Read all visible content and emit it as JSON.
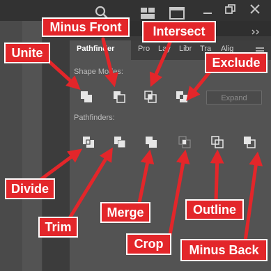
{
  "panel": {
    "tabs": [
      {
        "label": "Pathfinder",
        "active": true
      },
      {
        "label": "Pro",
        "active": false
      },
      {
        "label": "Lay",
        "active": false
      },
      {
        "label": "Libr",
        "active": false
      },
      {
        "label": "Tra",
        "active": false
      },
      {
        "label": "Alig",
        "active": false
      }
    ],
    "shape_modes_label": "Shape Modes:",
    "pathfinders_label": "Pathfinders:",
    "expand_label": "Expand"
  },
  "callouts": {
    "unite": "Unite",
    "minus_front": "Minus Front",
    "intersect": "Intersect",
    "exclude": "Exclude",
    "divide": "Divide",
    "trim": "Trim",
    "merge": "Merge",
    "crop": "Crop",
    "outline": "Outline",
    "minus_back": "Minus Back"
  },
  "icons": {
    "chrome": [
      "search-icon",
      "arrange-documents-icon",
      "workspace-icon",
      "minimize-icon",
      "restore-icon",
      "close-icon",
      "panel-menu-icon"
    ],
    "shape_modes": [
      "unite-icon",
      "minus-front-icon",
      "intersect-icon",
      "exclude-icon"
    ],
    "pathfinders": [
      "divide-icon",
      "trim-icon",
      "merge-icon",
      "crop-icon",
      "outline-icon",
      "minus-back-icon"
    ]
  },
  "colors": {
    "callout_bg": "#e3262a",
    "callout_border": "#ffffff",
    "arrow": "#e3262a",
    "panel_bg": "#535353"
  }
}
